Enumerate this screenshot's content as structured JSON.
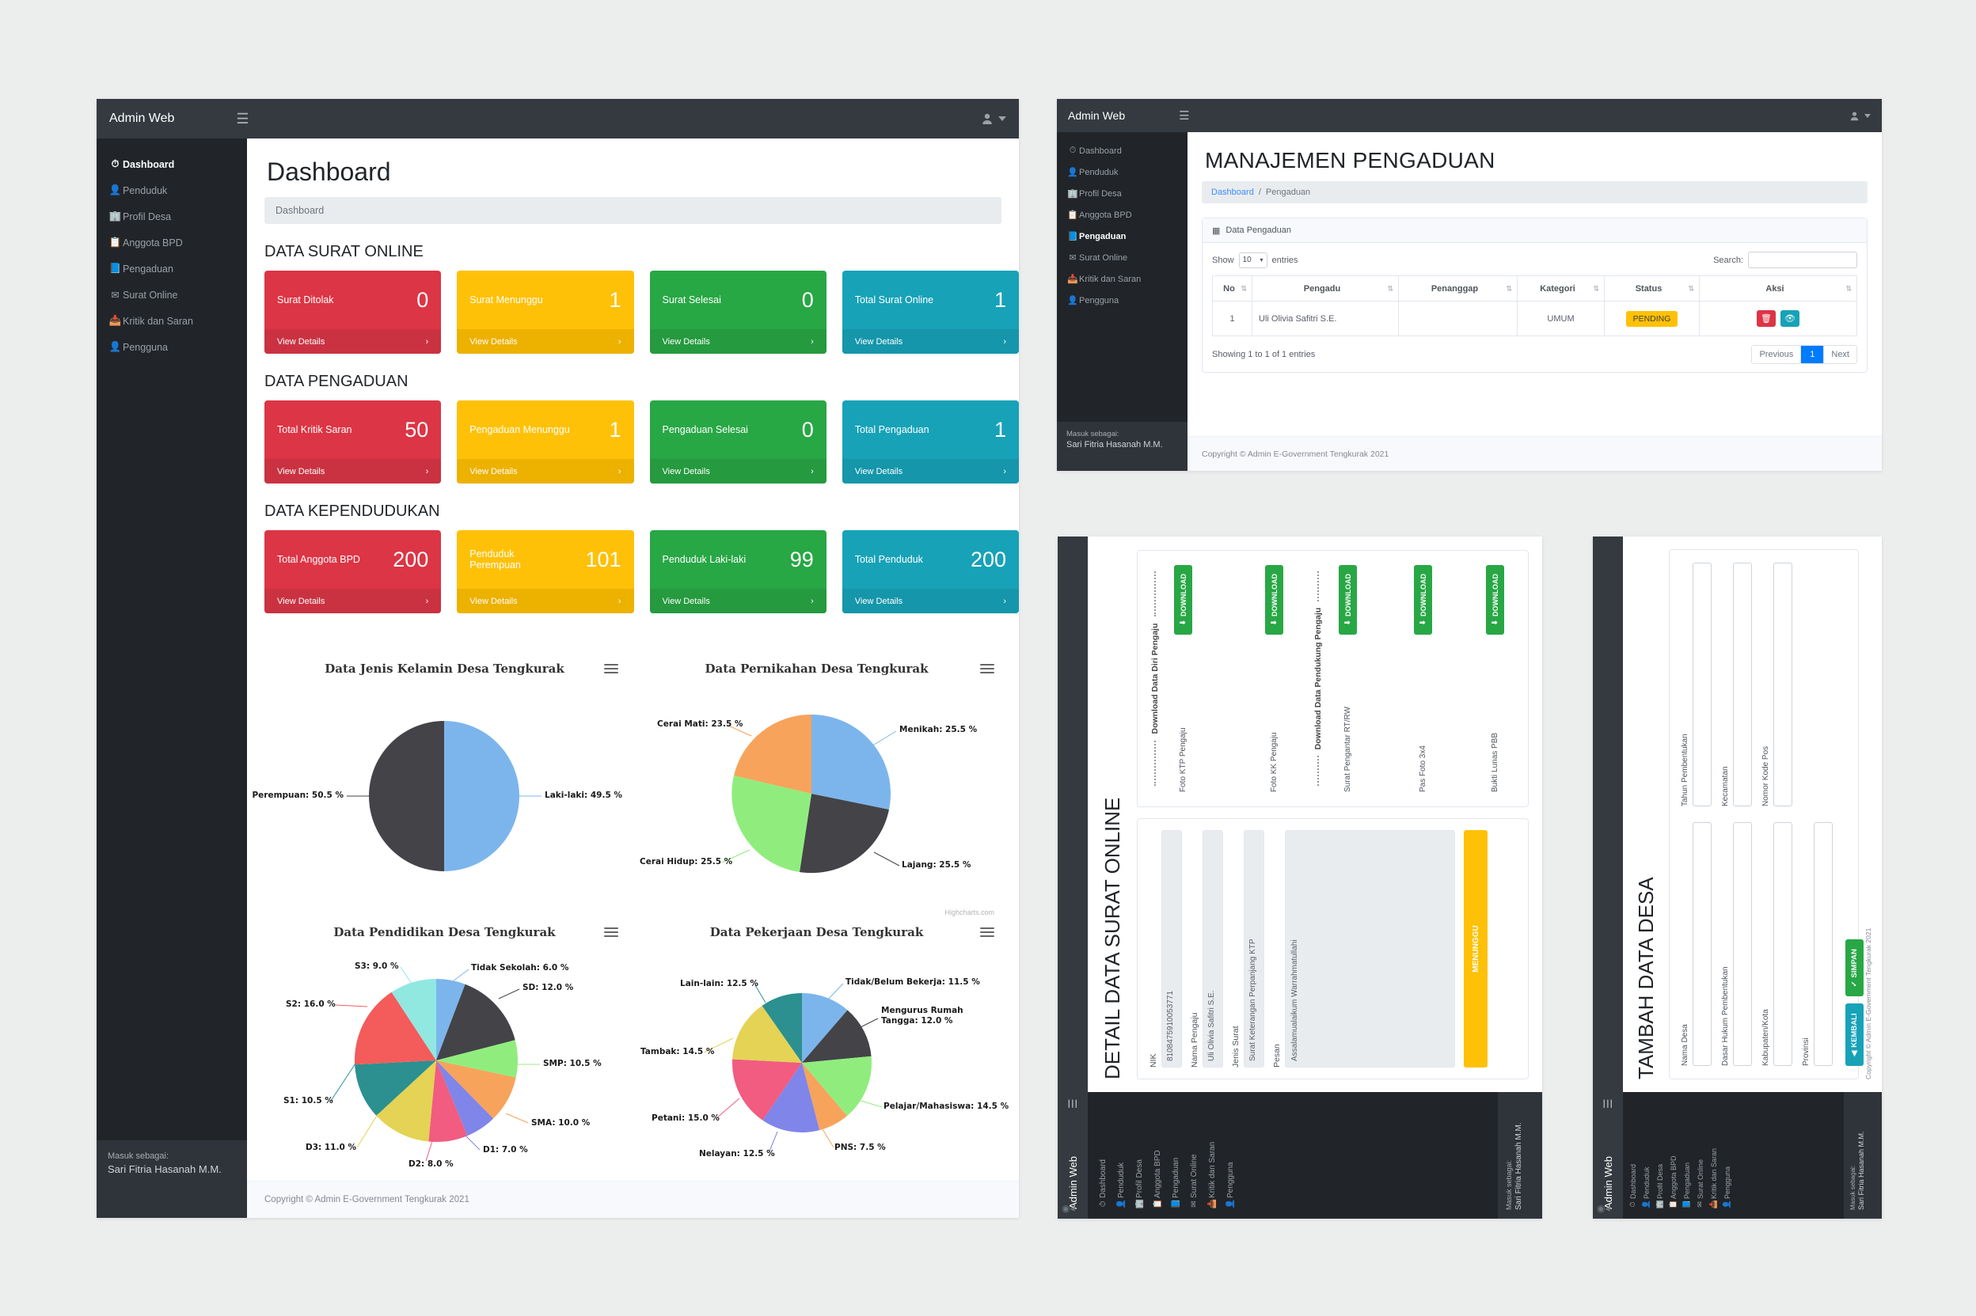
{
  "app": {
    "brand": "Admin Web",
    "hamburger_icon": "hamburger-icon",
    "user_icon": "user-icon",
    "caret_icon": "chevron-down-icon"
  },
  "sidebar": {
    "items": [
      {
        "label": "Dashboard",
        "icon": "speedometer-icon"
      },
      {
        "label": "Penduduk",
        "icon": "user-icon"
      },
      {
        "label": "Profil Desa",
        "icon": "building-icon"
      },
      {
        "label": "Anggota BPD",
        "icon": "id-card-icon"
      },
      {
        "label": "Pengaduan",
        "icon": "book-icon"
      },
      {
        "label": "Surat Online",
        "icon": "envelope-icon"
      },
      {
        "label": "Kritik dan Saran",
        "icon": "inbox-icon"
      },
      {
        "label": "Pengguna",
        "icon": "person-icon"
      }
    ],
    "footer_label": "Masuk sebagai:",
    "footer_user": "Sari Fitria Hasanah M.M."
  },
  "window1": {
    "page_title": "Dashboard",
    "breadcrumb": "Dashboard",
    "sections": [
      {
        "title": "DATA SURAT ONLINE",
        "cards": [
          {
            "label": "Surat Ditolak",
            "value": "0",
            "color": "red",
            "action": "View Details"
          },
          {
            "label": "Surat Menunggu",
            "value": "1",
            "color": "yellow",
            "action": "View Details"
          },
          {
            "label": "Surat Selesai",
            "value": "0",
            "color": "green",
            "action": "View Details"
          },
          {
            "label": "Total Surat Online",
            "value": "1",
            "color": "blue",
            "action": "View Details"
          }
        ]
      },
      {
        "title": "DATA PENGADUAN",
        "cards": [
          {
            "label": "Total Kritik Saran",
            "value": "50",
            "color": "red",
            "action": "View Details"
          },
          {
            "label": "Pengaduan Menunggu",
            "value": "1",
            "color": "yellow",
            "action": "View Details"
          },
          {
            "label": "Pengaduan Selesai",
            "value": "0",
            "color": "green",
            "action": "View Details"
          },
          {
            "label": "Total Pengaduan",
            "value": "1",
            "color": "blue",
            "action": "View Details"
          }
        ]
      },
      {
        "title": "DATA KEPENDUDUKAN",
        "cards": [
          {
            "label": "Total Anggota BPD",
            "value": "200",
            "color": "red",
            "action": "View Details"
          },
          {
            "label": "Penduduk Perempuan",
            "value": "101",
            "color": "yellow",
            "action": "View Details"
          },
          {
            "label": "Penduduk Laki-laki",
            "value": "99",
            "color": "green",
            "action": "View Details"
          },
          {
            "label": "Total Penduduk",
            "value": "200",
            "color": "blue",
            "action": "View Details"
          }
        ]
      }
    ],
    "credit": "Highcharts.com",
    "footer": "Copyright © Admin E-Government Tengkurak 2021"
  },
  "chart_data": [
    {
      "type": "pie",
      "title": "Data Jenis Kelamin Desa Tengkurak",
      "labels": [
        "Laki-laki",
        "Perempuan"
      ],
      "values": [
        49.5,
        50.5
      ],
      "unit": "%",
      "colors": [
        "#7cb5ec",
        "#434348"
      ],
      "legend": "none",
      "data_labels": [
        "Laki-laki: 49.5 %",
        "Perempuan: 50.5 %"
      ]
    },
    {
      "type": "pie",
      "title": "Data Pernikahan Desa Tengkurak",
      "labels": [
        "Menikah",
        "Lajang",
        "Cerai Hidup",
        "Cerai Mati"
      ],
      "values": [
        25.5,
        25.5,
        25.5,
        23.5
      ],
      "unit": "%",
      "colors": [
        "#7cb5ec",
        "#434348",
        "#90ed7d",
        "#f7a35c"
      ],
      "legend": "none",
      "data_labels": [
        "Menikah: 25.5 %",
        "Lajang: 25.5 %",
        "Cerai Hidup: 25.5 %",
        "Cerai Mati: 23.5 %"
      ]
    },
    {
      "type": "pie",
      "title": "Data Pendidikan Desa Tengkurak",
      "labels": [
        "Tidak Sekolah",
        "SD",
        "SMP",
        "SMA",
        "D1",
        "D2",
        "D3",
        "S1",
        "S2",
        "S3"
      ],
      "values": [
        6.0,
        12.0,
        10.5,
        10.0,
        7.0,
        8.0,
        11.0,
        10.5,
        16.0,
        9.0
      ],
      "unit": "%",
      "colors": [
        "#7cb5ec",
        "#434348",
        "#90ed7d",
        "#f7a35c",
        "#8085e9",
        "#f15c80",
        "#e4d354",
        "#2b908f",
        "#f45b5b",
        "#91e8e1"
      ],
      "legend": "none",
      "data_labels": [
        "Tidak Sekolah: 6.0 %",
        "SD: 12.0 %",
        "SMP: 10.5 %",
        "SMA: 10.0 %",
        "D1: 7.0 %",
        "D2: 8.0 %",
        "D3: 11.0 %",
        "S1: 10.5 %",
        "S2: 16.0 %",
        "S3: 9.0 %"
      ]
    },
    {
      "type": "pie",
      "title": "Data Pekerjaan Desa Tengkurak",
      "labels": [
        "Tidak/Belum Bekerja",
        "Mengurus Rumah Tangga",
        "Pelajar/Mahasiswa",
        "PNS",
        "Nelayan",
        "Petani",
        "Tambak",
        "Lain-lain"
      ],
      "values": [
        11.5,
        12.0,
        14.5,
        7.5,
        12.5,
        15.0,
        14.5,
        12.5
      ],
      "unit": "%",
      "colors": [
        "#7cb5ec",
        "#434348",
        "#90ed7d",
        "#f7a35c",
        "#8085e9",
        "#f15c80",
        "#e4d354",
        "#2b908f"
      ],
      "legend": "none",
      "data_labels": [
        "Tidak/Belum Bekerja: 11.5 %",
        "Mengurus Rumah Tangga: 12.0 %",
        "Pelajar/Mahasiswa: 14.5 %",
        "PNS: 7.5 %",
        "Nelayan: 12.5 %",
        "Petani: 15.0 %",
        "Tambak: 14.5 %",
        "Lain-lain: 12.5 %"
      ]
    }
  ],
  "window2": {
    "page_title": "MANAJEMEN PENGADUAN",
    "breadcrumb_home": "Dashboard",
    "breadcrumb_sep": "/",
    "breadcrumb_current": "Pengaduan",
    "panel_title": "Data Pengaduan",
    "panel_icon": "table-icon",
    "show_label": "Show",
    "show_value": "10",
    "entries_label": "entries",
    "search_label": "Search:",
    "search_value": "",
    "columns": [
      "No",
      "Pengadu",
      "Penanggap",
      "Kategori",
      "Status",
      "Aksi"
    ],
    "rows": [
      {
        "no": "1",
        "pengadu": "Uli Olivia Safitri S.E.",
        "penanggap": "",
        "kategori": "UMUM",
        "status": "PENDING",
        "actions": [
          {
            "icon": "trash-icon",
            "style": "btn-del"
          },
          {
            "icon": "eye-icon",
            "style": "btn-eye"
          }
        ]
      }
    ],
    "info": "Showing 1 to 1 of 1 entries",
    "pagination": {
      "previous": "Previous",
      "pages": [
        "1"
      ],
      "next": "Next"
    },
    "footer": "Copyright © Admin E-Government Tengkurak 2021"
  },
  "window3": {
    "page_title": "DETAIL DATA SURAT ONLINE",
    "fields": [
      {
        "label": "NIK",
        "value": "8108475910053771"
      },
      {
        "label": "Nama Pengaju",
        "value": "Uli Olivia Safitri S.E."
      },
      {
        "label": "Jenis Surat",
        "value": "Surat Keterangan Perpanjang KTP"
      },
      {
        "label": "Pesan",
        "value": "Assalamualaikum Warrahmatullahi"
      }
    ],
    "status": "MENUNGGU",
    "divider1": "Download Data Diri Pengaju",
    "divider2": "Download Data Pendukung Pengaju",
    "downloads_left": [
      {
        "label": "Foto KTP Pengaju",
        "button": "DOWNLOAD",
        "icon": "download-icon"
      },
      {
        "label": "Foto KK Pengaju",
        "button": "DOWNLOAD",
        "icon": "download-icon"
      }
    ],
    "downloads_right": [
      {
        "label": "Surat Pengantar RT/RW",
        "button": "DOWNLOAD",
        "icon": "download-icon"
      },
      {
        "label": "Pas Foto 3x4",
        "button": "DOWNLOAD",
        "icon": "download-icon"
      },
      {
        "label": "Bukti Lunas PBB",
        "button": "DOWNLOAD",
        "icon": "download-icon"
      }
    ]
  },
  "window4": {
    "page_title": "TAMBAH DATA DESA",
    "fields": [
      {
        "label": "Nama Desa",
        "value": ""
      },
      {
        "label": "Tahun Pembentukan",
        "value": ""
      },
      {
        "label": "Dasar Hukum Pembentukan",
        "value": ""
      },
      {
        "label": "Kecamatan",
        "value": ""
      },
      {
        "label": "Kabupaten/Kota",
        "value": ""
      },
      {
        "label": "Nomor Kode Pos",
        "value": ""
      },
      {
        "label": "Provinsi",
        "value": ""
      }
    ],
    "buttons": [
      {
        "label": "KEMBALI",
        "icon": "back-circle-icon",
        "style": "btn-cy"
      },
      {
        "label": "SIMPAN",
        "icon": "save-icon",
        "style": "btn-gr"
      }
    ],
    "footer": "Copyright © Admin E-Government Tengkurak 2021"
  }
}
